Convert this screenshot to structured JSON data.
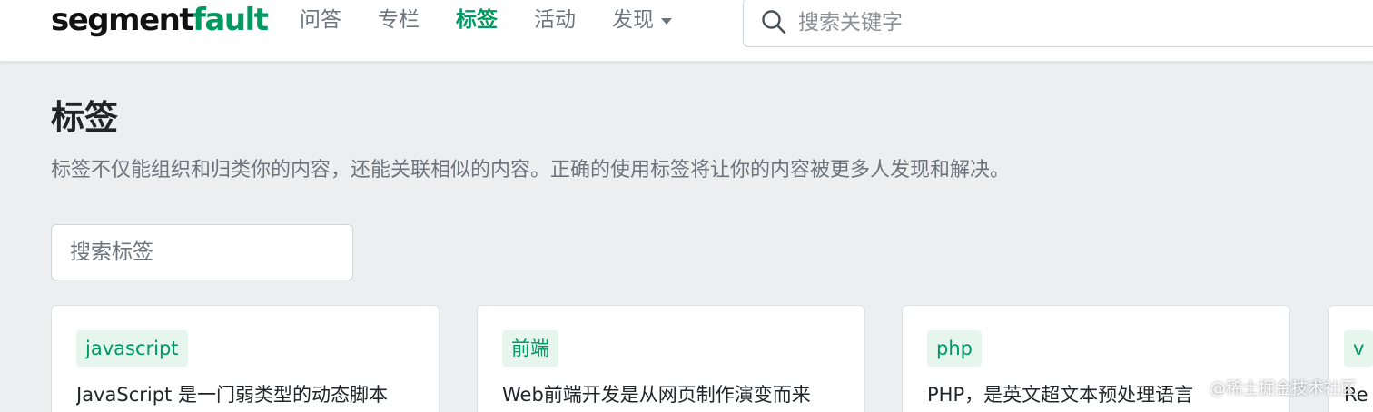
{
  "header": {
    "logo_part1": "segment",
    "logo_part2": "fault",
    "nav": [
      "问答",
      "专栏",
      "标签",
      "活动",
      "发现"
    ],
    "search_placeholder": "搜索关键字"
  },
  "page": {
    "title": "标签",
    "description": "标签不仅能组织和归类你的内容，还能关联相似的内容。正确的使用标签将让你的内容被更多人发现和解决。",
    "tag_search_placeholder": "搜索标签"
  },
  "cards": [
    {
      "tag": "javascript",
      "desc": "JavaScript 是一门弱类型的动态脚本"
    },
    {
      "tag": "前端",
      "desc": "Web前端开发是从网页制作演变而来"
    },
    {
      "tag": "php",
      "desc": "PHP，是英文超文本预处理语言"
    },
    {
      "tag": "v",
      "desc": "Re"
    }
  ],
  "watermark": "@稀土掘金技术社区",
  "colors": {
    "brand": "#009a61",
    "tag_bg": "#e6f5ee",
    "page_bg": "#eceeef"
  },
  "icons": {
    "search": "search-icon",
    "dropdown": "caret-down-icon"
  }
}
